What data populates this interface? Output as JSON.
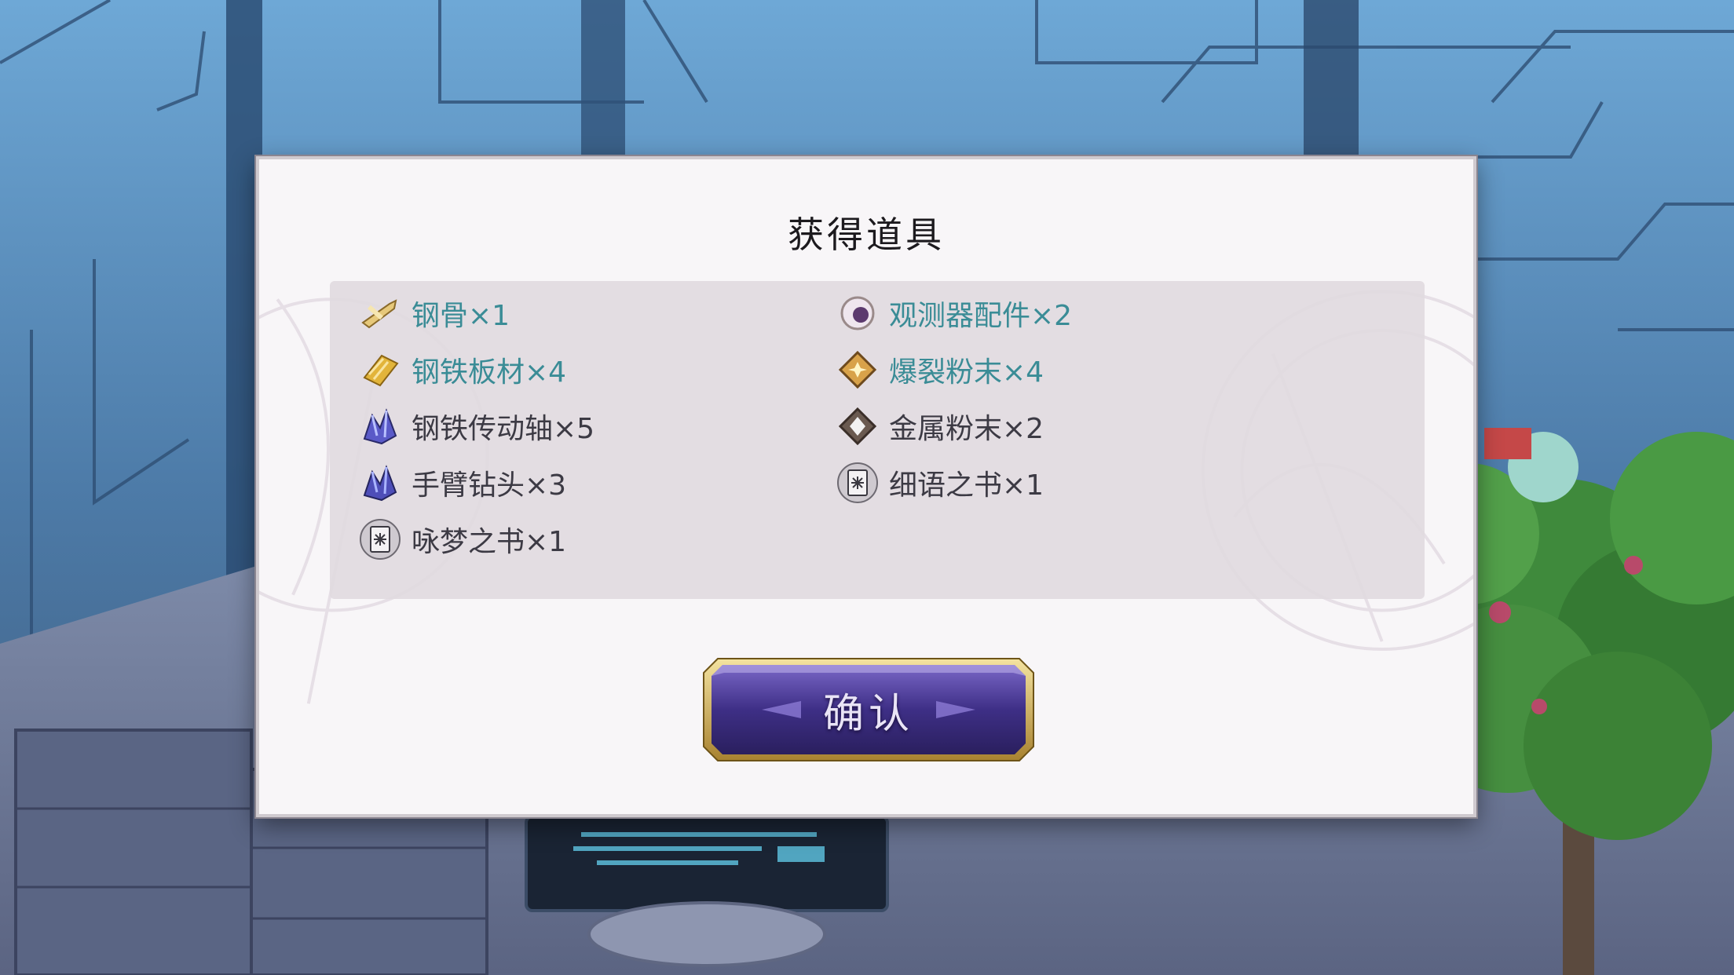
{
  "dialog": {
    "title": "获得道具",
    "confirm_label": "确认"
  },
  "items": [
    {
      "label": "钢骨×1",
      "icon": "steel-bone-icon",
      "highlight": true
    },
    {
      "label": "观测器配件×2",
      "icon": "orb-part-icon",
      "highlight": true
    },
    {
      "label": "钢铁板材×4",
      "icon": "steel-plate-icon",
      "highlight": true
    },
    {
      "label": "爆裂粉末×4",
      "icon": "burst-powder-icon",
      "highlight": true
    },
    {
      "label": "钢铁传动轴×5",
      "icon": "crystal-shaft-icon",
      "highlight": false
    },
    {
      "label": "金属粉末×2",
      "icon": "metal-powder-icon",
      "highlight": false
    },
    {
      "label": "手臂钻头×3",
      "icon": "crystal-drill-icon",
      "highlight": false
    },
    {
      "label": "细语之书×1",
      "icon": "book-icon",
      "highlight": false
    },
    {
      "label": "咏梦之书×1",
      "icon": "book-icon",
      "highlight": false
    }
  ],
  "colors": {
    "highlight_text": "#3a8c96",
    "normal_text": "#3c3a44",
    "button_fill": "#4a3a8c",
    "button_frame": "#c9a94a"
  }
}
